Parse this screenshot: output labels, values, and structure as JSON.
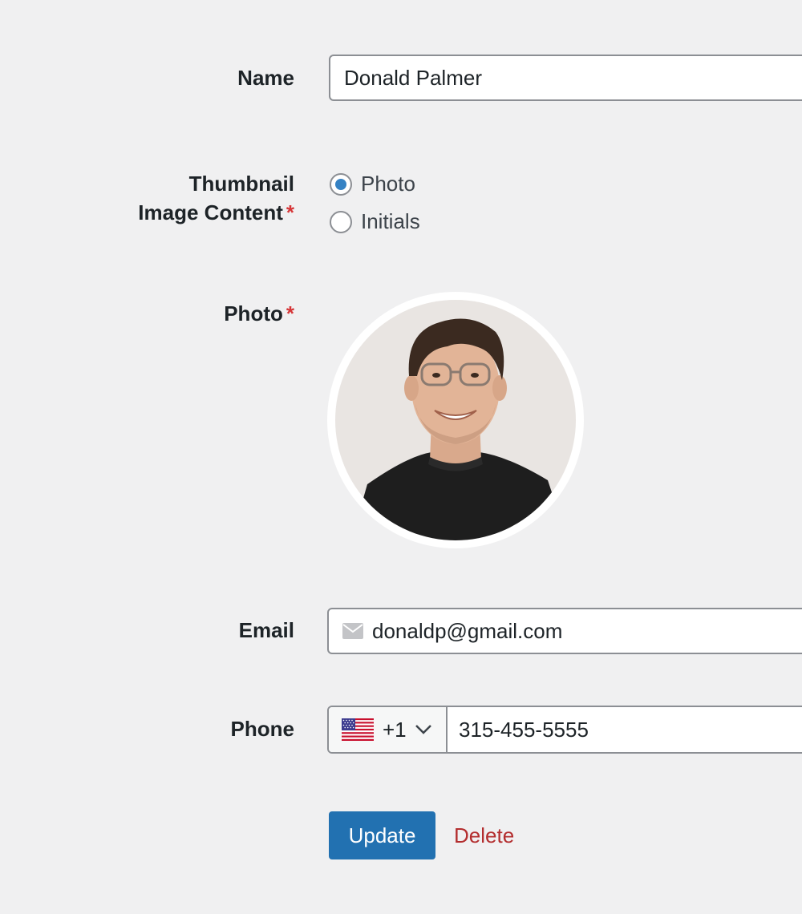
{
  "fields": {
    "name": {
      "label": "Name",
      "value": "Donald Palmer"
    },
    "thumbnail": {
      "label_line1": "Thumbnail",
      "label_line2": "Image Content",
      "required_mark": "*",
      "options": [
        {
          "label": "Photo",
          "selected": true
        },
        {
          "label": "Initials",
          "selected": false
        }
      ]
    },
    "photo": {
      "label": "Photo",
      "required_mark": "*"
    },
    "email": {
      "label": "Email",
      "value": "donaldp@gmail.com",
      "icon": "envelope-icon"
    },
    "phone": {
      "label": "Phone",
      "country_code": "+1",
      "country_flag": "us-flag-icon",
      "value": "315-455-5555"
    }
  },
  "actions": {
    "update_label": "Update",
    "delete_label": "Delete"
  },
  "colors": {
    "background": "#f0f0f1",
    "primary": "#2271b1",
    "radio_checked": "#3582c4",
    "delete": "#b32d2e",
    "required": "#d63638",
    "border": "#8c8f94"
  }
}
